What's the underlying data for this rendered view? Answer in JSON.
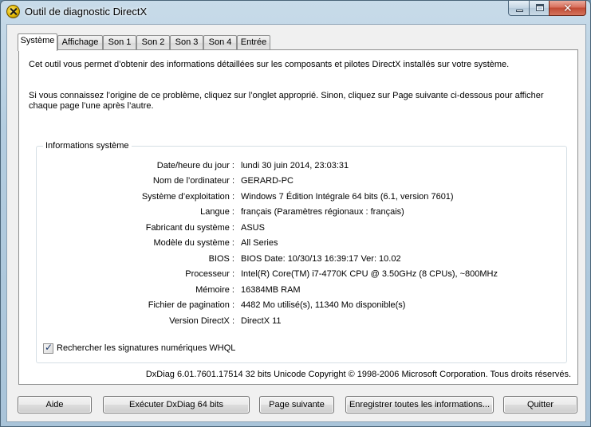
{
  "window": {
    "title": "Outil de diagnostic DirectX",
    "close_glyph": "✕"
  },
  "tabs": [
    {
      "label": "Système",
      "active": true
    },
    {
      "label": "Affichage",
      "active": false
    },
    {
      "label": "Son 1",
      "active": false
    },
    {
      "label": "Son 2",
      "active": false
    },
    {
      "label": "Son 3",
      "active": false
    },
    {
      "label": "Son 4",
      "active": false
    },
    {
      "label": "Entrée",
      "active": false
    }
  ],
  "intro": {
    "line1": "Cet outil vous permet d’obtenir des informations détaillées sur les composants et pilotes DirectX installés sur votre système.",
    "line2": "Si vous connaissez l’origine de ce problème, cliquez sur l’onglet approprié. Sinon, cliquez sur Page suivante ci-dessous pour afficher chaque page l’une après l’autre."
  },
  "system_info": {
    "group_title": "Informations système",
    "rows": [
      {
        "label": "Date/heure du jour :",
        "value": "lundi 30 juin 2014, 23:03:31"
      },
      {
        "label": "Nom de l’ordinateur :",
        "value": "GERARD-PC"
      },
      {
        "label": "Système d’exploitation :",
        "value": "Windows 7 Édition Intégrale 64 bits (6.1, version 7601)"
      },
      {
        "label": "Langue :",
        "value": "français (Paramètres régionaux : français)"
      },
      {
        "label": "Fabricant du système :",
        "value": "ASUS"
      },
      {
        "label": "Modèle du système :",
        "value": "All Series"
      },
      {
        "label": "BIOS :",
        "value": "BIOS Date: 10/30/13 16:39:17 Ver: 10.02"
      },
      {
        "label": "Processeur :",
        "value": "Intel(R) Core(TM) i7-4770K CPU @ 3.50GHz (8 CPUs), ~800MHz"
      },
      {
        "label": "Mémoire :",
        "value": "16384MB RAM"
      },
      {
        "label": "Fichier de pagination :",
        "value": "4482 Mo utilisé(s), 11340 Mo disponible(s)"
      },
      {
        "label": "Version DirectX :",
        "value": "DirectX 11"
      }
    ]
  },
  "whql_checkbox": {
    "label": "Rechercher les signatures numériques WHQL",
    "checked": true,
    "check_glyph": "✓"
  },
  "footer_info": "DxDiag 6.01.7601.17514 32 bits Unicode Copyright © 1998-2006 Microsoft Corporation. Tous droits réservés.",
  "buttons": {
    "help": "Aide",
    "run64": "Exécuter DxDiag 64 bits",
    "next_page": "Page suivante",
    "save_all": "Enregistrer toutes les informations...",
    "quit": "Quitter"
  }
}
